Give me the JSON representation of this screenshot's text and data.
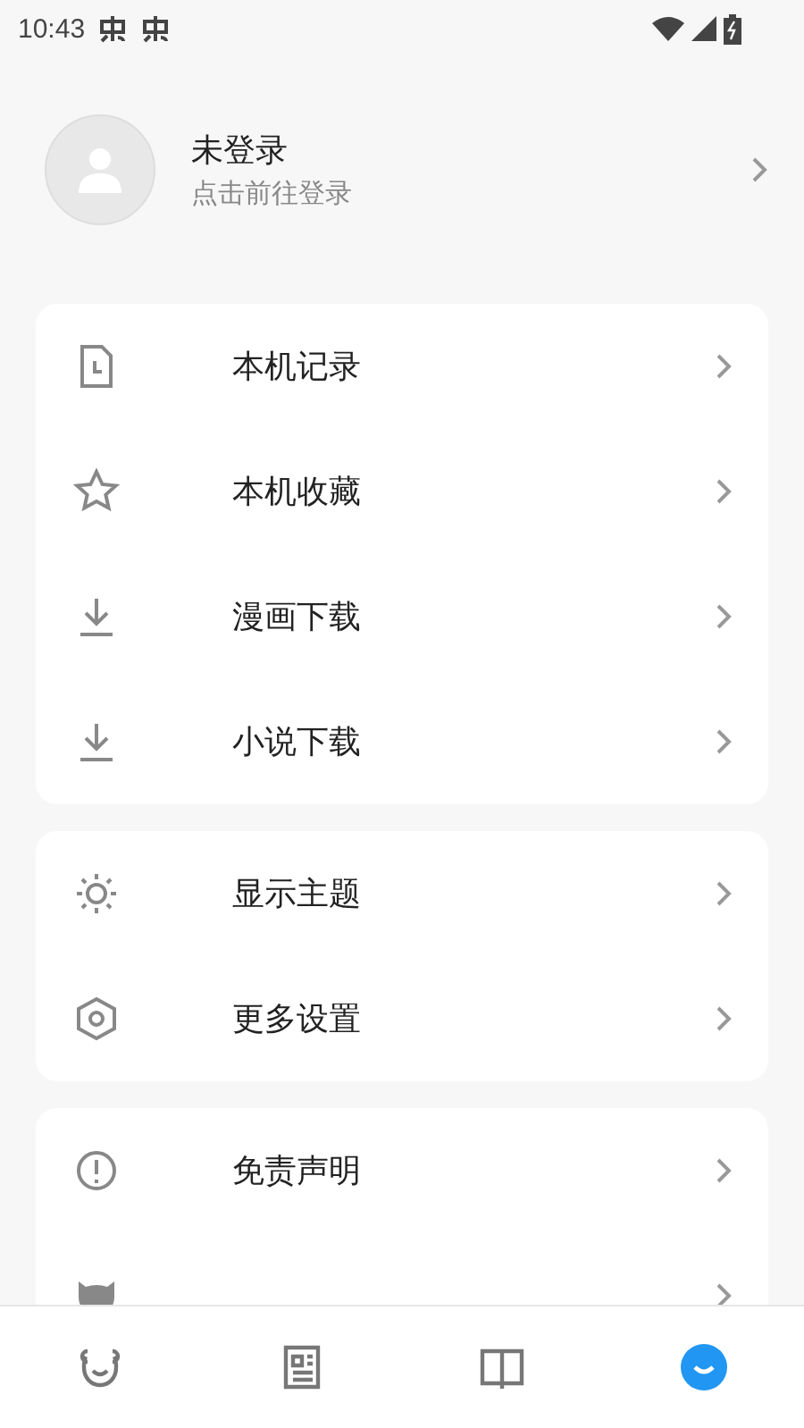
{
  "status_bar": {
    "time": "10:43"
  },
  "profile": {
    "name": "未登录",
    "subtitle": "点击前往登录"
  },
  "groups": [
    {
      "items": [
        {
          "kind": "link",
          "label": "本机记录"
        },
        {
          "kind": "link",
          "label": "本机收藏"
        },
        {
          "kind": "link",
          "label": "漫画下载"
        },
        {
          "kind": "link",
          "label": "小说下载"
        }
      ]
    },
    {
      "items": [
        {
          "kind": "link",
          "label": "显示主题"
        },
        {
          "kind": "link",
          "label": "更多设置"
        }
      ]
    },
    {
      "items": [
        {
          "kind": "link",
          "label": "免责声明"
        },
        {
          "kind": "cut_off"
        }
      ]
    }
  ],
  "bottom_nav": [
    {
      "selected": false
    },
    {
      "selected": false
    },
    {
      "selected": false
    },
    {
      "selected": true
    }
  ]
}
